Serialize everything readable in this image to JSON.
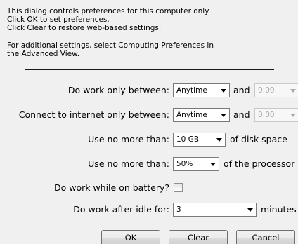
{
  "intro": {
    "line1": "This dialog controls preferences for this computer only.",
    "line2": "Click OK to set preferences.",
    "line3": "Click Clear to restore web-based settings.",
    "line4": "For additional settings, select Computing Preferences in",
    "line5": "the Advanced View."
  },
  "work_between": {
    "label": "Do work only between:",
    "start_value": "Anytime",
    "and_label": "and",
    "end_value": "0:00"
  },
  "internet_between": {
    "label": "Connect to internet only between:",
    "start_value": "Anytime",
    "and_label": "and",
    "end_value": "0:00"
  },
  "disk": {
    "label": "Use no more than:",
    "value": "10 GB",
    "suffix": "of disk space"
  },
  "processor": {
    "label": "Use no more than:",
    "value": "50%",
    "suffix": "of the processor"
  },
  "battery": {
    "label": "Do work while on battery?",
    "checked": false
  },
  "idle": {
    "label": "Do work after idle for:",
    "value": "3",
    "suffix": "minutes"
  },
  "buttons": {
    "ok": "OK",
    "clear": "Clear",
    "cancel": "Cancel"
  },
  "icons": {
    "dropdown": "chevron-down-icon"
  }
}
